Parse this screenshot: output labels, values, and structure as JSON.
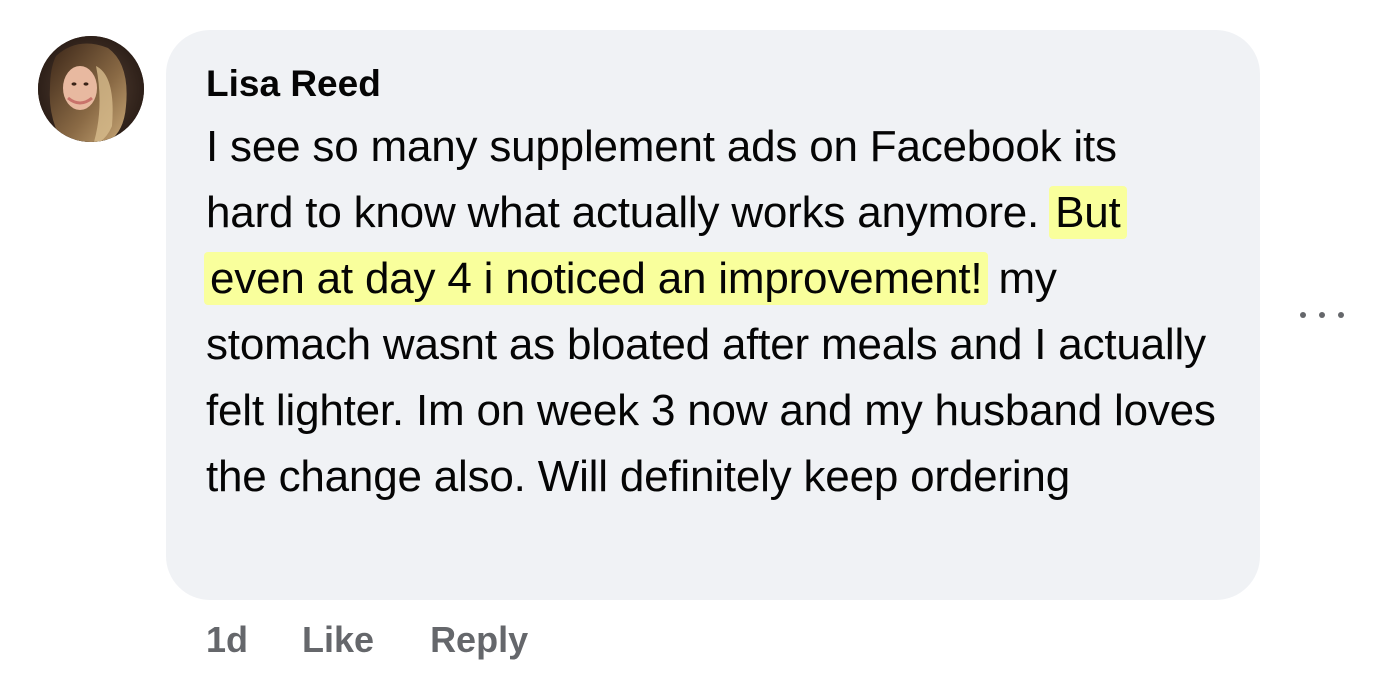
{
  "comment": {
    "author": "Lisa Reed",
    "text_before": "I see so many supplement ads on Facebook its hard to know what actually works anymore. ",
    "text_highlighted": "But even at day 4 i noticed an improvement!",
    "text_after": " my stomach wasnt as bloated after meals and I actually felt lighter. Im on week 3 now and my husband loves the change also. Will definitely keep ordering",
    "timestamp": "1d",
    "like_label": "Like",
    "reply_label": "Reply",
    "more_icon": "more-horizontal-icon"
  },
  "colors": {
    "bubble_bg": "#f0f2f5",
    "highlight": "#f9ff9c",
    "text": "#050505",
    "meta_text": "#65676b"
  }
}
